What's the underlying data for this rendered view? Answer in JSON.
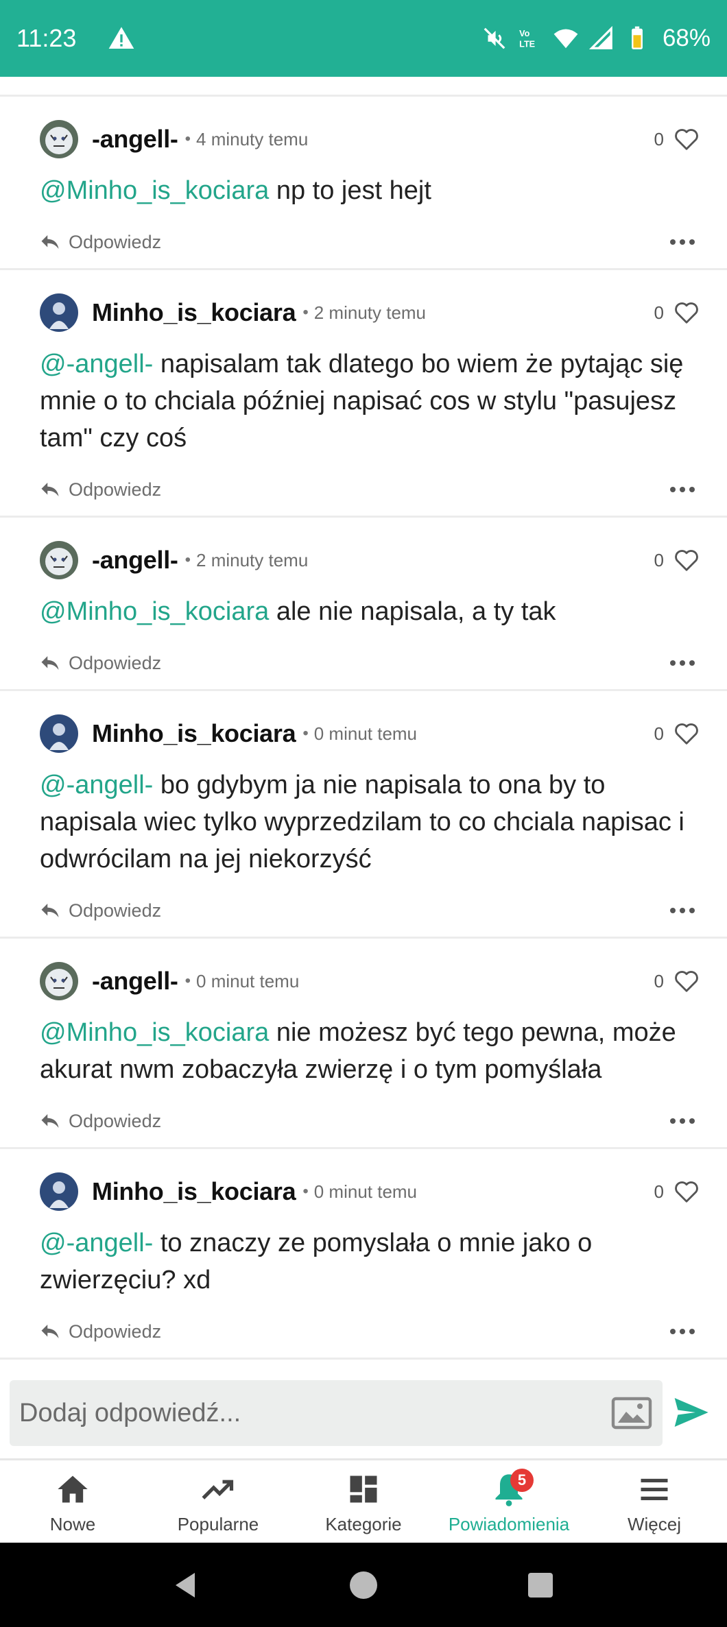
{
  "status_bar": {
    "time": "11:23",
    "battery": "68%",
    "icons": [
      "warning-icon",
      "mute-icon",
      "volte-icon",
      "wifi-icon",
      "signal-icon",
      "battery-icon"
    ]
  },
  "comments": [
    {
      "author": "-angell-",
      "avatar": "tiger-avatar",
      "time": "4 minuty temu",
      "likes": "0",
      "mention": "@Minho_is_kociara",
      "text": " np to jest hejt",
      "reply_label": "Odpowiedz"
    },
    {
      "author": "Minho_is_kociara",
      "avatar": "figure-avatar",
      "time": "2 minuty temu",
      "likes": "0",
      "mention": "@-angell-",
      "text": " napisalam tak dlatego bo wiem że pytając się mnie o to chciala później napisać cos w stylu \"pasujesz tam\" czy coś",
      "reply_label": "Odpowiedz"
    },
    {
      "author": "-angell-",
      "avatar": "tiger-avatar",
      "time": "2 minuty temu",
      "likes": "0",
      "mention": "@Minho_is_kociara",
      "text": " ale nie napisala, a ty tak",
      "reply_label": "Odpowiedz"
    },
    {
      "author": "Minho_is_kociara",
      "avatar": "figure-avatar",
      "time": "0 minut temu",
      "likes": "0",
      "mention": "@-angell-",
      "text": " bo gdybym ja nie napisala to ona by to napisala wiec tylko wyprzedzilam to co chciala napisac i odwrócilam na jej niekorzyść",
      "reply_label": "Odpowiedz"
    },
    {
      "author": "-angell-",
      "avatar": "tiger-avatar",
      "time": "0 minut temu",
      "likes": "0",
      "mention": "@Minho_is_kociara",
      "text": " nie możesz być tego pewna, może akurat nwm zobaczyła zwierzę i o tym pomyślała",
      "reply_label": "Odpowiedz"
    },
    {
      "author": "Minho_is_kociara",
      "avatar": "figure-avatar",
      "time": "0 minut temu",
      "likes": "0",
      "mention": "@-angell-",
      "text": " to znaczy ze pomyslała o mnie jako o zwierzęciu? xd",
      "reply_label": "Odpowiedz"
    }
  ],
  "composer": {
    "placeholder": "Dodaj odpowiedź..."
  },
  "bottom_nav": {
    "items": [
      {
        "label": "Nowe",
        "icon": "home-icon"
      },
      {
        "label": "Popularne",
        "icon": "trending-icon"
      },
      {
        "label": "Kategorie",
        "icon": "categories-icon"
      },
      {
        "label": "Powiadomienia",
        "icon": "bell-icon",
        "badge": "5",
        "active": true
      },
      {
        "label": "Więcej",
        "icon": "menu-icon"
      }
    ]
  },
  "colors": {
    "brand": "#22b094",
    "mention": "#22a58a",
    "badge": "#e53935"
  }
}
